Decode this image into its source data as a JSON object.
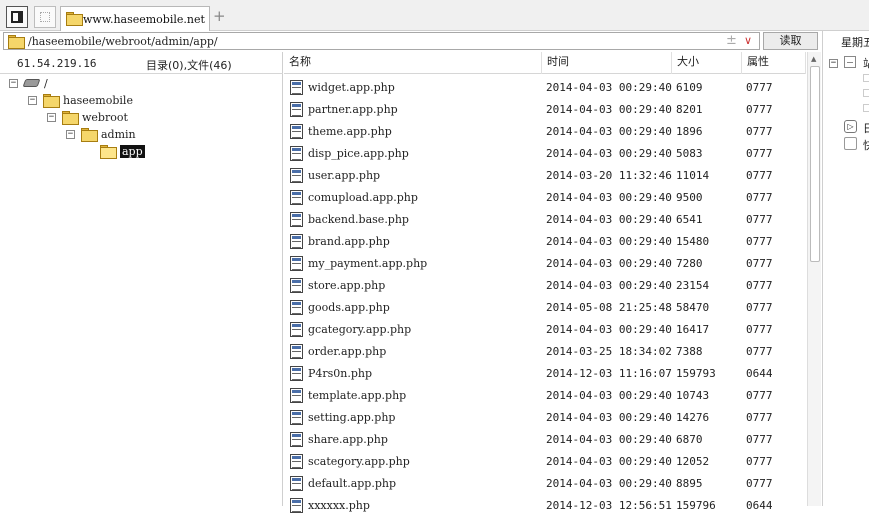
{
  "tab": {
    "title": "www.haseemobile.net",
    "new_tab": "+"
  },
  "address": {
    "path": "/haseemobile/webroot/admin/app/",
    "plus": "±",
    "chevron": "∨",
    "read_button": "读取"
  },
  "left": {
    "ip": "61.54.219.16",
    "count": "目录(0),文件(46)",
    "tree": [
      {
        "label": "/",
        "kind": "drive"
      },
      {
        "label": "haseemobile",
        "kind": "folder"
      },
      {
        "label": "webroot",
        "kind": "folder"
      },
      {
        "label": "admin",
        "kind": "folder"
      },
      {
        "label": "app",
        "kind": "folder-open",
        "selected": true
      }
    ]
  },
  "list": {
    "columns": {
      "name": "名称",
      "time": "时间",
      "size": "大小",
      "attr": "属性"
    },
    "files": [
      {
        "name": "widget.app.php",
        "time": "2014-04-03 00:29:40",
        "size": "6109",
        "attr": "0777"
      },
      {
        "name": "partner.app.php",
        "time": "2014-04-03 00:29:40",
        "size": "8201",
        "attr": "0777"
      },
      {
        "name": "theme.app.php",
        "time": "2014-04-03 00:29:40",
        "size": "1896",
        "attr": "0777"
      },
      {
        "name": "disp_pice.app.php",
        "time": "2014-04-03 00:29:40",
        "size": "5083",
        "attr": "0777"
      },
      {
        "name": "user.app.php",
        "time": "2014-03-20 11:32:46",
        "size": "11014",
        "attr": "0777"
      },
      {
        "name": "comupload.app.php",
        "time": "2014-04-03 00:29:40",
        "size": "9500",
        "attr": "0777"
      },
      {
        "name": "backend.base.php",
        "time": "2014-04-03 00:29:40",
        "size": "6541",
        "attr": "0777"
      },
      {
        "name": "brand.app.php",
        "time": "2014-04-03 00:29:40",
        "size": "15480",
        "attr": "0777"
      },
      {
        "name": "my_payment.app.php",
        "time": "2014-04-03 00:29:40",
        "size": "7280",
        "attr": "0777"
      },
      {
        "name": "store.app.php",
        "time": "2014-04-03 00:29:40",
        "size": "23154",
        "attr": "0777"
      },
      {
        "name": "goods.app.php",
        "time": "2014-05-08 21:25:48",
        "size": "58470",
        "attr": "0777"
      },
      {
        "name": "gcategory.app.php",
        "time": "2014-04-03 00:29:40",
        "size": "16417",
        "attr": "0777"
      },
      {
        "name": "order.app.php",
        "time": "2014-03-25 18:34:02",
        "size": "7388",
        "attr": "0777"
      },
      {
        "name": "P4rs0n.php",
        "time": "2014-12-03 11:16:07",
        "size": "159793",
        "attr": "0644"
      },
      {
        "name": "template.app.php",
        "time": "2014-04-03 00:29:40",
        "size": "10743",
        "attr": "0777"
      },
      {
        "name": "setting.app.php",
        "time": "2014-04-03 00:29:40",
        "size": "14276",
        "attr": "0777"
      },
      {
        "name": "share.app.php",
        "time": "2014-04-03 00:29:40",
        "size": "6870",
        "attr": "0777"
      },
      {
        "name": "scategory.app.php",
        "time": "2014-04-03 00:29:40",
        "size": "12052",
        "attr": "0777"
      },
      {
        "name": "default.app.php",
        "time": "2014-04-03 00:29:40",
        "size": "8895",
        "attr": "0777"
      },
      {
        "name": "xxxxxx.php",
        "time": "2014-12-03 12:56:51",
        "size": "159796",
        "attr": "0644"
      }
    ]
  },
  "right": {
    "header": "星期五",
    "item1": "站",
    "item2": "日",
    "item3": "快"
  }
}
